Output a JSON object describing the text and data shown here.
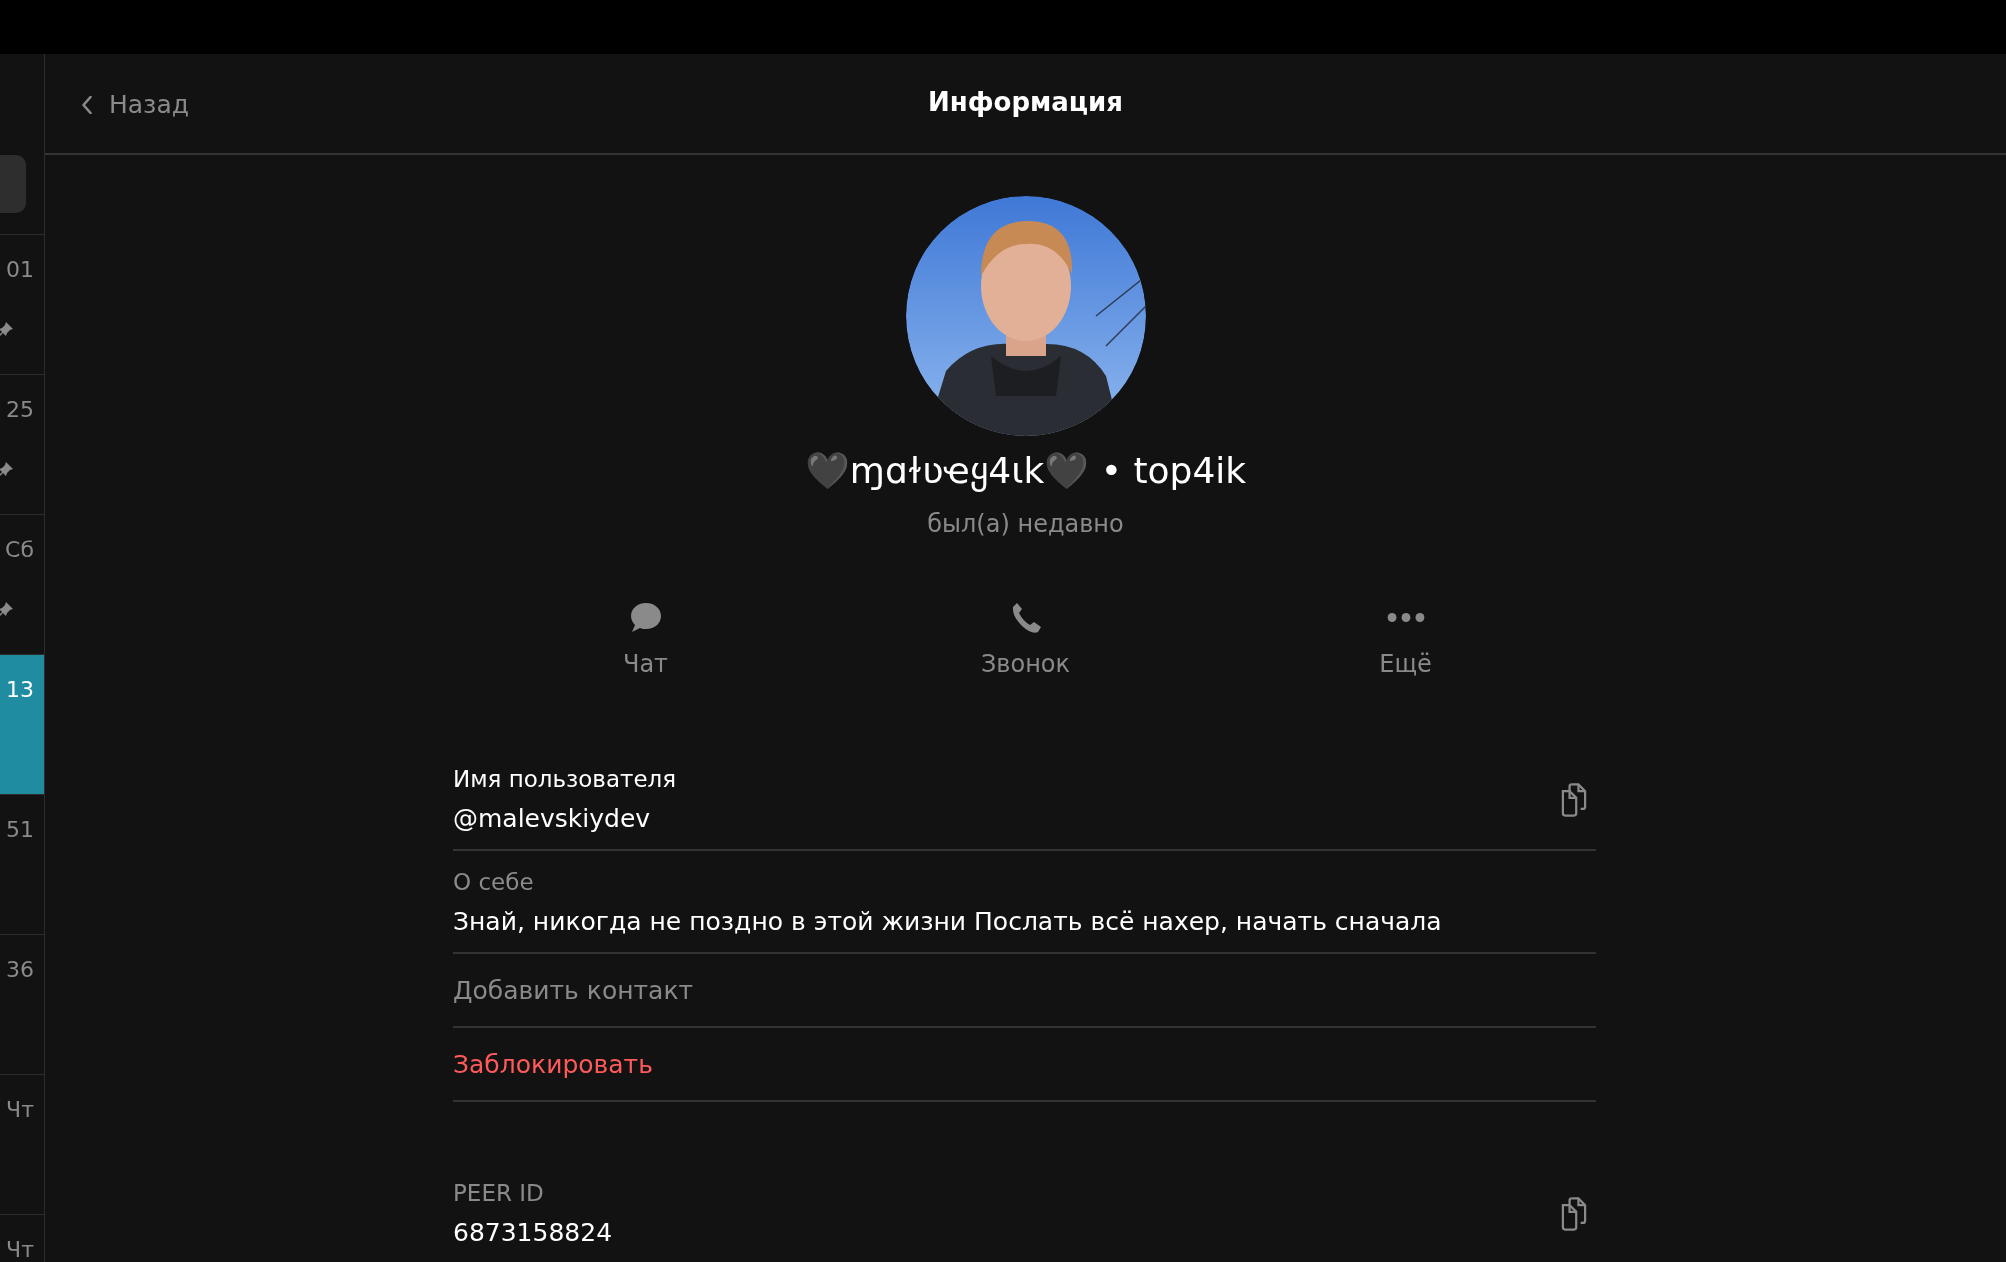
{
  "sidebar": {
    "items": [
      {
        "time": "01",
        "pinned": true,
        "selected": false
      },
      {
        "time": "25",
        "pinned": true,
        "selected": false
      },
      {
        "time": "Сб",
        "pinned": true,
        "selected": false
      },
      {
        "time": "13",
        "pinned": false,
        "selected": true
      },
      {
        "time": "51",
        "pinned": false,
        "selected": false
      },
      {
        "time": "36",
        "pinned": false,
        "selected": false
      },
      {
        "time": "Чт",
        "pinned": false,
        "selected": false
      },
      {
        "time": "Чт",
        "selected": false
      }
    ]
  },
  "header": {
    "back": "Назад",
    "title": "Информация"
  },
  "profile": {
    "name": "🖤ɱɑɫʋҽყ4ιk🖤 • top4ik",
    "status": "был(а) недавно"
  },
  "actions": [
    {
      "kind": "chat",
      "label": "Чат"
    },
    {
      "kind": "call",
      "label": "Звонок"
    },
    {
      "kind": "more",
      "label": "Ещё"
    }
  ],
  "fields": [
    {
      "kind": "info",
      "label": "Имя пользователя",
      "value": "@malevskiydev",
      "emphasized": true,
      "copyable": true,
      "spaced": false
    },
    {
      "kind": "info",
      "label": "О себе",
      "value": "Знай, никогда не поздно в этой жизни Послать всё нахер, начать сначала",
      "emphasized": false,
      "copyable": false,
      "spaced": false
    },
    {
      "kind": "action",
      "label": "Добавить контакт",
      "destructive": false
    },
    {
      "kind": "action",
      "label": "Заблокировать",
      "destructive": true
    },
    {
      "kind": "info",
      "label": "PEER ID",
      "value": "6873158824",
      "emphasized": false,
      "copyable": true,
      "spaced": true
    }
  ]
}
